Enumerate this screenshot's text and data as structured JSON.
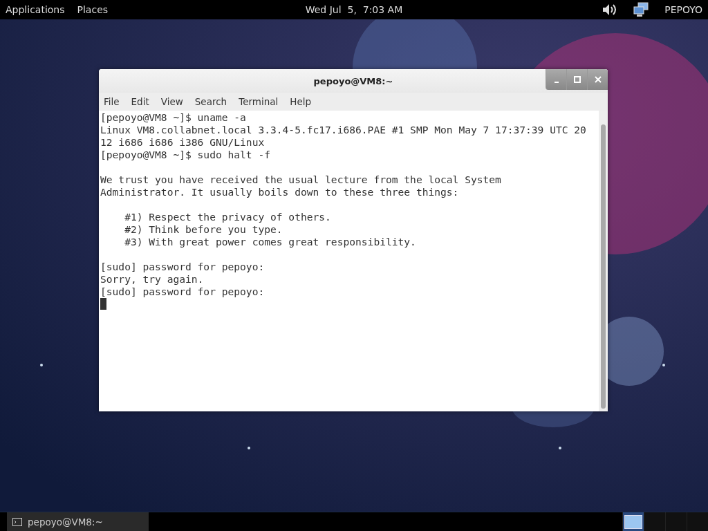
{
  "top_bar": {
    "menus": [
      "Applications",
      "Places"
    ],
    "clock": "Wed Jul  5,  7:03 AM",
    "user": "PEPOYO"
  },
  "window": {
    "title": "pepoyo@VM8:~",
    "menu": [
      "File",
      "Edit",
      "View",
      "Search",
      "Terminal",
      "Help"
    ],
    "terminal": {
      "blocks": [
        [
          "[pepoyo@VM8 ~]$ uname -a",
          "Linux VM8.collabnet.local 3.3.4-5.fc17.i686.PAE #1 SMP Mon May 7 17:37:39 UTC 20",
          "12 i686 i686 i386 GNU/Linux",
          "[pepoyo@VM8 ~]$ sudo halt -f"
        ],
        [
          "We trust you have received the usual lecture from the local System",
          "Administrator. It usually boils down to these three things:"
        ],
        [
          "    #1) Respect the privacy of others.",
          "    #2) Think before you type.",
          "    #3) With great power comes great responsibility."
        ],
        [
          "[sudo] password for pepoyo:",
          "Sorry, try again.",
          "[sudo] password for pepoyo:"
        ]
      ]
    }
  },
  "taskbar": {
    "tasks": [
      {
        "label": "pepoyo@VM8:~",
        "selected": false
      }
    ],
    "workspaces": [
      {
        "selected": true
      },
      {
        "selected": false
      },
      {
        "selected": false
      },
      {
        "selected": false
      }
    ]
  }
}
